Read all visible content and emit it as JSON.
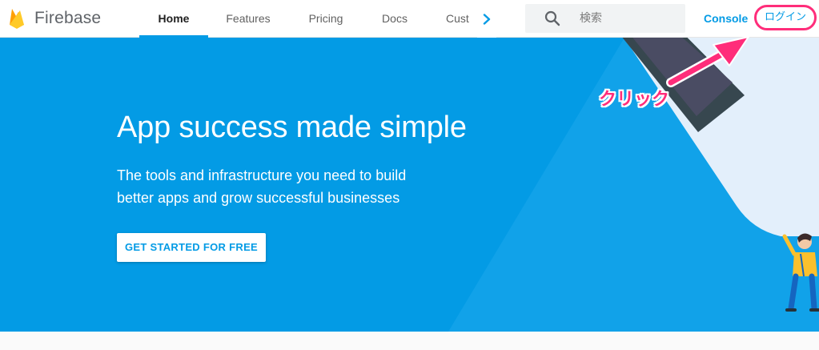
{
  "brand": {
    "name": "Firebase"
  },
  "nav": {
    "tabs": [
      {
        "label": "Home",
        "active": true
      },
      {
        "label": "Features",
        "active": false
      },
      {
        "label": "Pricing",
        "active": false
      },
      {
        "label": "Docs",
        "active": false
      },
      {
        "label": "Cust",
        "active": false
      }
    ],
    "more_icon": "chevron-right-icon"
  },
  "search": {
    "placeholder": "検索",
    "icon": "search-icon"
  },
  "console_label": "Console",
  "login_label": "ログイン",
  "hero": {
    "title": "App success made simple",
    "subtitle_line1": "The tools and infrastructure you need to build",
    "subtitle_line2": "better apps and grow successful businesses",
    "cta_label": "GET STARTED FOR FREE"
  },
  "annotation": {
    "text": "クリック",
    "color": "#ff2d7a"
  },
  "colors": {
    "accent": "#039be5",
    "hero_bg": "#039be5",
    "highlight": "#ff2d7a"
  }
}
